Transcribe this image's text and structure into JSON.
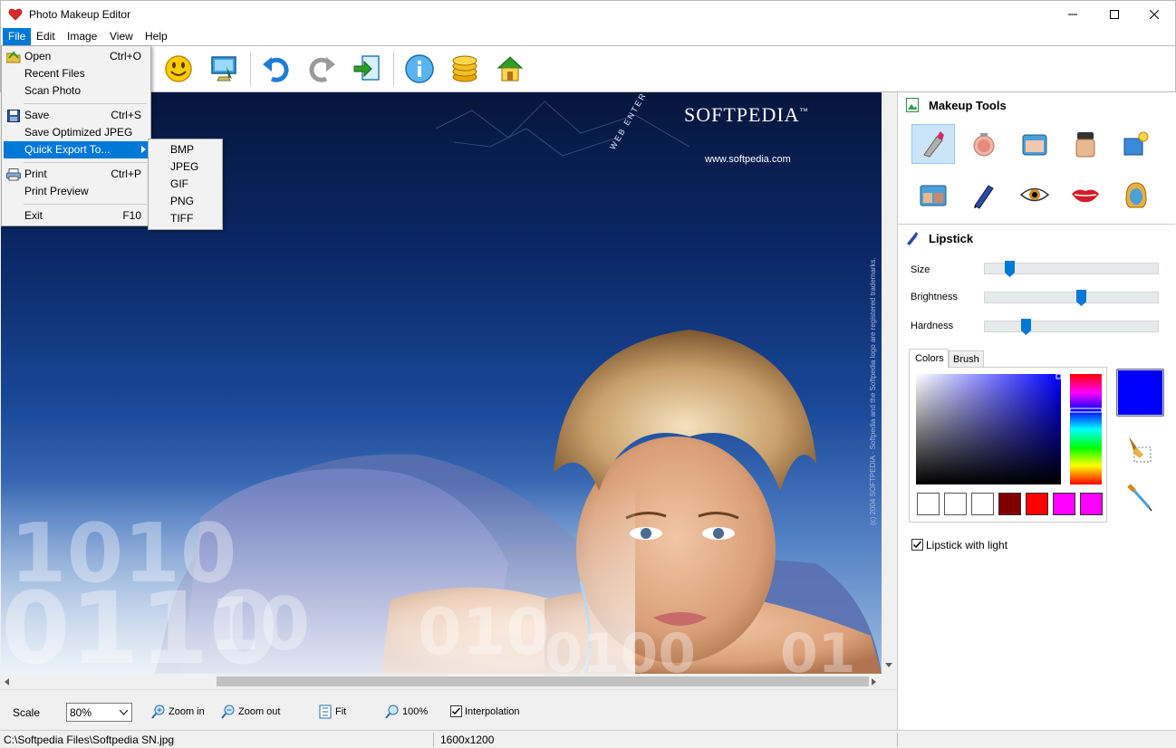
{
  "window": {
    "title": "Photo Makeup Editor"
  },
  "menubar": {
    "items": [
      "File",
      "Edit",
      "Image",
      "View",
      "Help"
    ]
  },
  "file_menu": {
    "items": [
      {
        "label": "Open",
        "shortcut": "Ctrl+O"
      },
      {
        "label": "Recent Files",
        "shortcut": ""
      },
      {
        "label": "Scan Photo",
        "shortcut": ""
      },
      {
        "label": "Save",
        "shortcut": "Ctrl+S"
      },
      {
        "label": "Save Optimized JPEG",
        "shortcut": ""
      },
      {
        "label": "Quick Export To...",
        "shortcut": ""
      },
      {
        "label": "Print",
        "shortcut": "Ctrl+P"
      },
      {
        "label": "Print Preview",
        "shortcut": ""
      },
      {
        "label": "Exit",
        "shortcut": "F10"
      }
    ]
  },
  "export_submenu": {
    "items": [
      "BMP",
      "JPEG",
      "GIF",
      "PNG",
      "TIFF"
    ]
  },
  "canvas": {
    "logo": "SOFTPEDIA",
    "tm": "™",
    "url": "www.softpedia.com",
    "tagline": "WEB ENTERTAINMENT",
    "copyright": "(c) 2004 SOFTPEDIA · Softpedia and the Softpedia logo are registered trademarks."
  },
  "makeup_tools": {
    "title": "Makeup Tools",
    "tools": [
      "lipstick",
      "blush",
      "powder-compact",
      "foundation",
      "background",
      "eyeshadow-palette",
      "eye-pencil",
      "eye",
      "lips",
      "hair"
    ]
  },
  "lipstick": {
    "title": "Lipstick",
    "size_label": "Size",
    "brightness_label": "Brightness",
    "hardness_label": "Hardness",
    "size": 0.12,
    "brightness": 0.56,
    "hardness": 0.22,
    "tabs": [
      "Colors",
      "Brush"
    ],
    "current_color": "#0000ff",
    "swatches": [
      "#ffffff",
      "#ffffff",
      "#ffffff",
      "#800000",
      "#ff0000",
      "#ff00ff",
      "#ff00ff"
    ],
    "light_label": "Lipstick with light",
    "light_checked": true
  },
  "bottombar": {
    "scale_label": "Scale",
    "scale_value": "80%",
    "zoom_in": "Zoom in",
    "zoom_out": "Zoom out",
    "fit": "Fit",
    "hundred": "100%",
    "interpolation": "Interpolation"
  },
  "status": {
    "path": "C:\\Softpedia Files\\Softpedia SN.jpg",
    "dimensions": "1600x1200"
  },
  "colors": {
    "accent": "#0078d7"
  }
}
